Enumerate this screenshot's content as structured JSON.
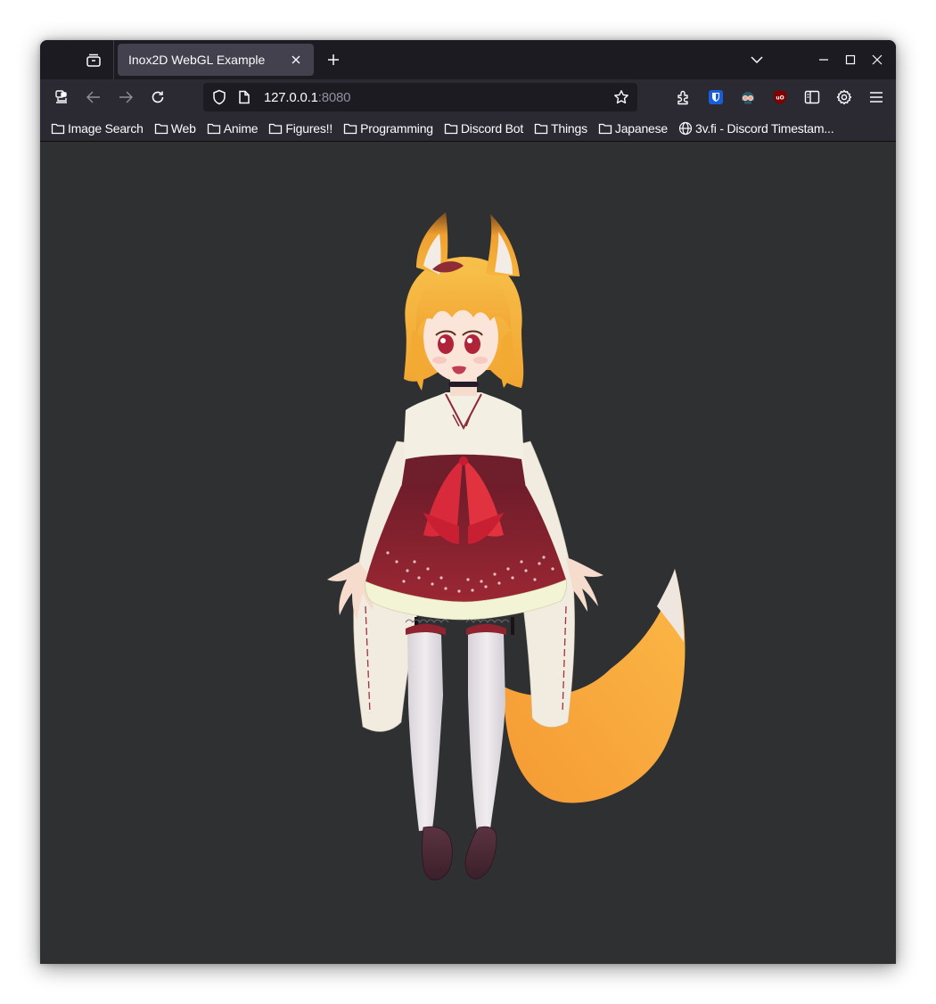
{
  "browser": {
    "tab": {
      "title": "Inox2D WebGL Example",
      "close_icon": "close-icon"
    },
    "tab_strip_icons": {
      "tab_manager": "tab-manager-icon",
      "new_tab": "plus-icon",
      "list_all_tabs": "chevron-down-icon"
    },
    "window_controls": {
      "minimize": "minimize-icon",
      "maximize": "maximize-icon",
      "close": "close-icon"
    },
    "nav": {
      "sidebar": "sidebar-remote-icon",
      "back": "back-arrow-icon",
      "forward": "forward-arrow-icon",
      "reload": "reload-icon"
    },
    "urlbar": {
      "host": "127.0.0.1",
      "port": ":8080",
      "tracking_protection_icon": "shield-icon",
      "page_info_icon": "page-icon",
      "bookmark_icon": "star-icon"
    },
    "toolbar_right": [
      {
        "name": "extensions",
        "icon": "puzzle-icon"
      },
      {
        "name": "bitwarden",
        "icon": "bitwarden-shield-icon"
      },
      {
        "name": "privacy-badger-like",
        "icon": "robot-goggles-icon"
      },
      {
        "name": "ublock-origin",
        "icon": "ublock-shield-icon"
      },
      {
        "name": "reader-sidebar",
        "icon": "sidebar-icon"
      },
      {
        "name": "settings",
        "icon": "gear-icon"
      },
      {
        "name": "menu",
        "icon": "hamburger-icon"
      }
    ],
    "bookmarks": [
      {
        "label": "Image Search",
        "icon": "folder-icon"
      },
      {
        "label": "Web",
        "icon": "folder-icon"
      },
      {
        "label": "Anime",
        "icon": "folder-icon"
      },
      {
        "label": "Figures!!",
        "icon": "folder-icon"
      },
      {
        "label": "Programming",
        "icon": "folder-icon"
      },
      {
        "label": "Discord Bot",
        "icon": "folder-icon"
      },
      {
        "label": "Things",
        "icon": "folder-icon"
      },
      {
        "label": "Japanese",
        "icon": "folder-icon"
      },
      {
        "label": "3v.fi - Discord Timestam...",
        "icon": "globe-icon"
      }
    ]
  },
  "page": {
    "content": "Inox2D WebGL rendered puppet: fox-eared girl in shrine maiden outfit with fox tail",
    "colors": {
      "background": "#2f3032",
      "hair": "#f6b23a",
      "skirt": "#8e2230",
      "bow": "#e02a3c",
      "robe": "#f3eee2",
      "stockings": "#e7e2e6",
      "shoes": "#4a2a35",
      "tail": "#f7a93b"
    }
  }
}
